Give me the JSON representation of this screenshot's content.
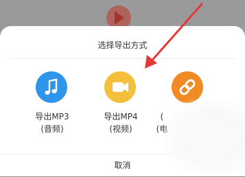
{
  "sheet": {
    "title": "选择导出方式",
    "cancel_label": "取消"
  },
  "options": [
    {
      "label_line1": "导出MP3",
      "label_line2": "(音频)",
      "icon": "music-note-icon",
      "color": "#2f95ea"
    },
    {
      "label_line1": "导出MP4",
      "label_line2": "(视频)",
      "icon": "video-camera-icon",
      "color": "#f4bf3a"
    },
    {
      "label_line1": "(",
      "label_line2": "(电",
      "icon": "link-icon",
      "color": "#f08a24"
    }
  ],
  "annotation": {
    "arrow_color": "#e53935"
  }
}
